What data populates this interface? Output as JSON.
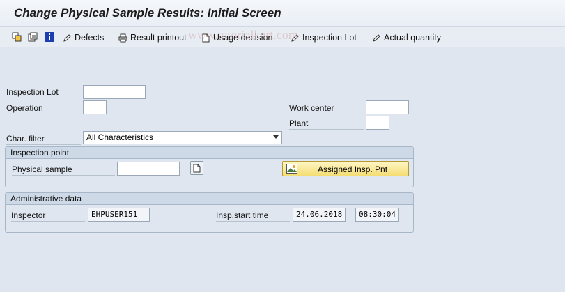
{
  "window": {
    "title": "Change Physical Sample Results: Initial Screen"
  },
  "toolbar": {
    "icons": [
      "other-object-icon",
      "change-display-icon",
      "info-icon"
    ],
    "buttons": [
      {
        "label": "Defects",
        "icon": "pencil-icon"
      },
      {
        "label": "Result printout",
        "icon": "printer-icon"
      },
      {
        "label": "Usage decision",
        "icon": "document-icon"
      },
      {
        "label": "Inspection Lot",
        "icon": "pencil-icon"
      },
      {
        "label": "Actual quantity",
        "icon": "pencil-icon"
      }
    ]
  },
  "watermark": "www.tutorialkart.com",
  "form": {
    "inspection_lot": {
      "label": "Inspection Lot",
      "value": ""
    },
    "operation": {
      "label": "Operation",
      "value": ""
    },
    "work_center": {
      "label": "Work center",
      "value": ""
    },
    "plant": {
      "label": "Plant",
      "value": ""
    },
    "char_filter": {
      "label": "Char. filter",
      "value": "All Characteristics"
    }
  },
  "inspection_point": {
    "title": "Inspection point",
    "physical_sample": {
      "label": "Physical sample",
      "value": ""
    },
    "assigned_button": "Assigned Insp. Pnt"
  },
  "administrative": {
    "title": "Administrative data",
    "inspector": {
      "label": "Inspector",
      "value": "EHPUSER151"
    },
    "start_time": {
      "label": "Insp.start time",
      "date": "24.06.2018",
      "time": "08:30:04"
    }
  },
  "colors": {
    "background": "#dfe6ef",
    "button_accent": "#f4dd72"
  }
}
